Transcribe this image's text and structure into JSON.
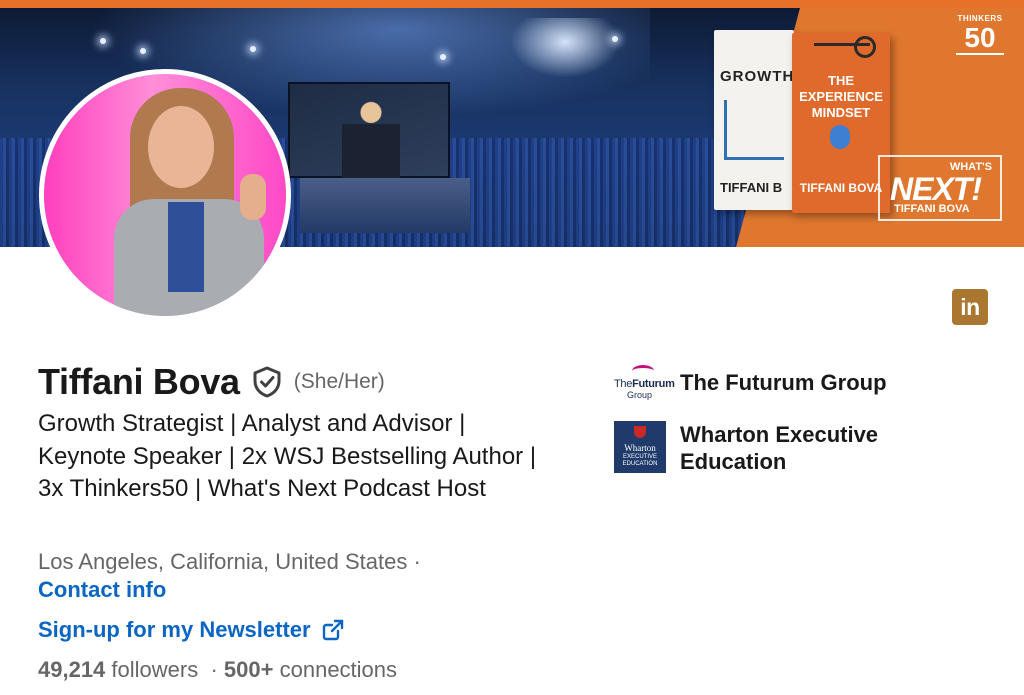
{
  "banner": {
    "book1": {
      "title": "GROWTH",
      "author": "TIFFANI B"
    },
    "book2": {
      "title_line1": "THE",
      "title_line2": "EXPERIENCE",
      "title_line3": "MINDSET",
      "author": "TIFFANI BOVA"
    },
    "thinkers": {
      "label": "THINKERS",
      "number": "50"
    },
    "podcast": {
      "whats": "WHAT'S",
      "next": "NEXT!",
      "byline": "TIFFANI BOVA"
    },
    "accent_color": "#e0772f"
  },
  "profile": {
    "name": "Tiffani Bova",
    "verified_icon": "shield-check-icon",
    "pronouns": "(She/Her)",
    "headline": "Growth Strategist | Analyst and Advisor | Keynote Speaker | 2x WSJ Bestselling Author | 3x Thinkers50 | What's Next Podcast Host",
    "location": "Los Angeles, California, United States ·",
    "contact_link": "Contact info",
    "newsletter_link": "Sign-up for my Newsletter",
    "followers_count": "49,214",
    "followers_label": "followers",
    "separator": "·",
    "connections_count": "500+",
    "connections_label": "connections",
    "link_color": "#0a66c2"
  },
  "linkedin_badge": {
    "label": "in",
    "color": "#a9772f"
  },
  "companies": [
    {
      "name": "The Futurum Group",
      "logo_line1": "The",
      "logo_line1_bold": "Futurum",
      "logo_line2": "Group"
    },
    {
      "name_line1": "Wharton Executive",
      "name_line2": "Education",
      "logo_line1": "Wharton",
      "logo_line2": "EXECUTIVE",
      "logo_line3": "EDUCATION"
    }
  ]
}
